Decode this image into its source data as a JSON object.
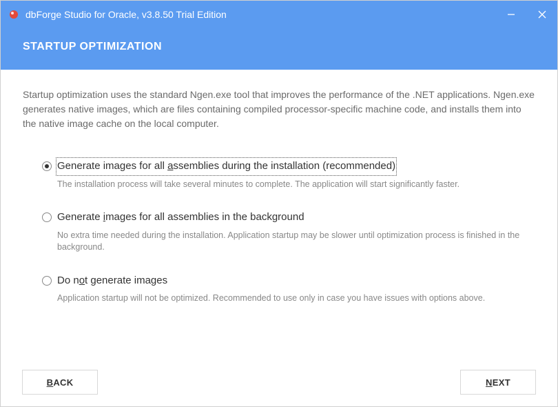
{
  "window": {
    "title": "dbForge Studio for Oracle, v3.8.50 Trial Edition"
  },
  "header": {
    "title": "STARTUP OPTIMIZATION"
  },
  "intro": "Startup optimization uses the standard Ngen.exe tool that improves the performance of the .NET applications. Ngen.exe generates native images, which are files containing compiled processor-specific machine code, and installs them into the native image cache on the local computer.",
  "options": [
    {
      "label_pre": "Generate images for all ",
      "mnemonic": "a",
      "label_post": "ssemblies during the installation (recommended)",
      "desc": "The installation process will take several minutes to complete. The application will start significantly faster.",
      "selected": true,
      "focused": true
    },
    {
      "label_pre": "Generate ",
      "mnemonic": "i",
      "label_post": "mages for all assemblies in the background",
      "desc": "No extra time needed during the installation. Application startup may be slower until optimization process is finished in the background.",
      "selected": false,
      "focused": false
    },
    {
      "label_pre": "Do n",
      "mnemonic": "o",
      "label_post": "t generate images",
      "desc": "Application startup will not be optimized. Recommended to use only in case you have issues with options above.",
      "selected": false,
      "focused": false
    }
  ],
  "buttons": {
    "back_pre": "",
    "back_mn": "B",
    "back_post": "ACK",
    "next_pre": "",
    "next_mn": "N",
    "next_post": "EXT"
  }
}
